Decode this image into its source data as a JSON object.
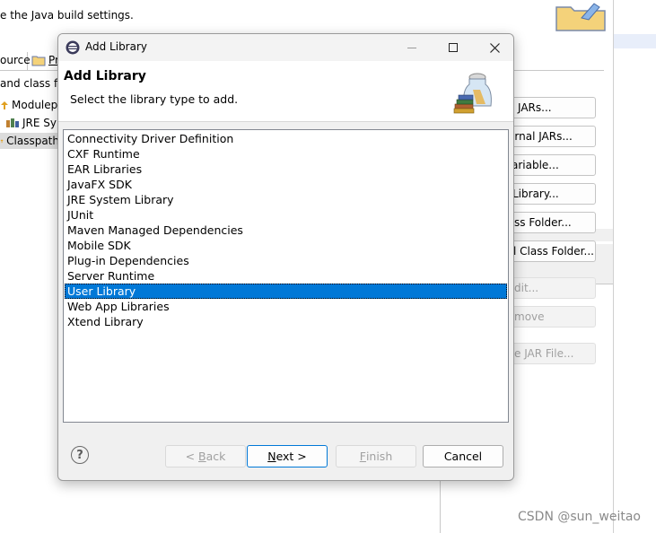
{
  "background": {
    "description": "e the Java build settings.",
    "tabs": [
      {
        "label": "ource"
      },
      {
        "label": "Pr"
      }
    ],
    "sub_label": "and class f",
    "tree": [
      {
        "label": "Modulep"
      },
      {
        "label": "JRE Sy"
      },
      {
        "label": "Classpath"
      }
    ],
    "buttons": [
      {
        "label": "JARs..."
      },
      {
        "label": "ernal JARs..."
      },
      {
        "label": "ariable..."
      },
      {
        "label": "Library..."
      },
      {
        "label": "ss Folder..."
      },
      {
        "label": "l Class Folder..."
      },
      {
        "label": "dit..."
      },
      {
        "label": "move"
      },
      {
        "label": "e JAR File..."
      }
    ]
  },
  "dialog": {
    "title": "Add Library",
    "header_title": "Add Library",
    "header_description": "Select the library type to add.",
    "libraries": [
      "Connectivity Driver Definition",
      "CXF Runtime",
      "EAR Libraries",
      "JavaFX SDK",
      "JRE System Library",
      "JUnit",
      "Maven Managed Dependencies",
      "Mobile SDK",
      "Plug-in Dependencies",
      "Server Runtime",
      "User Library",
      "Web App Libraries",
      "Xtend Library"
    ],
    "selected_library": "User Library",
    "help_label": "?",
    "back_prefix": "< ",
    "back_mnemonic": "B",
    "back_rest": "ack",
    "next_mnemonic": "N",
    "next_rest": "ext >",
    "finish_mnemonic": "F",
    "finish_rest": "inish",
    "cancel_label": "Cancel"
  },
  "watermark": "CSDN @sun_weitao",
  "colors": {
    "selection": "#0078d7",
    "dialog_bg": "#f0f0f0"
  },
  "icons": [
    "eclipse-icon",
    "minimize-icon",
    "maximize-icon",
    "close-icon",
    "library-jar-icon",
    "help-icon",
    "folder-icon",
    "package-icon"
  ]
}
